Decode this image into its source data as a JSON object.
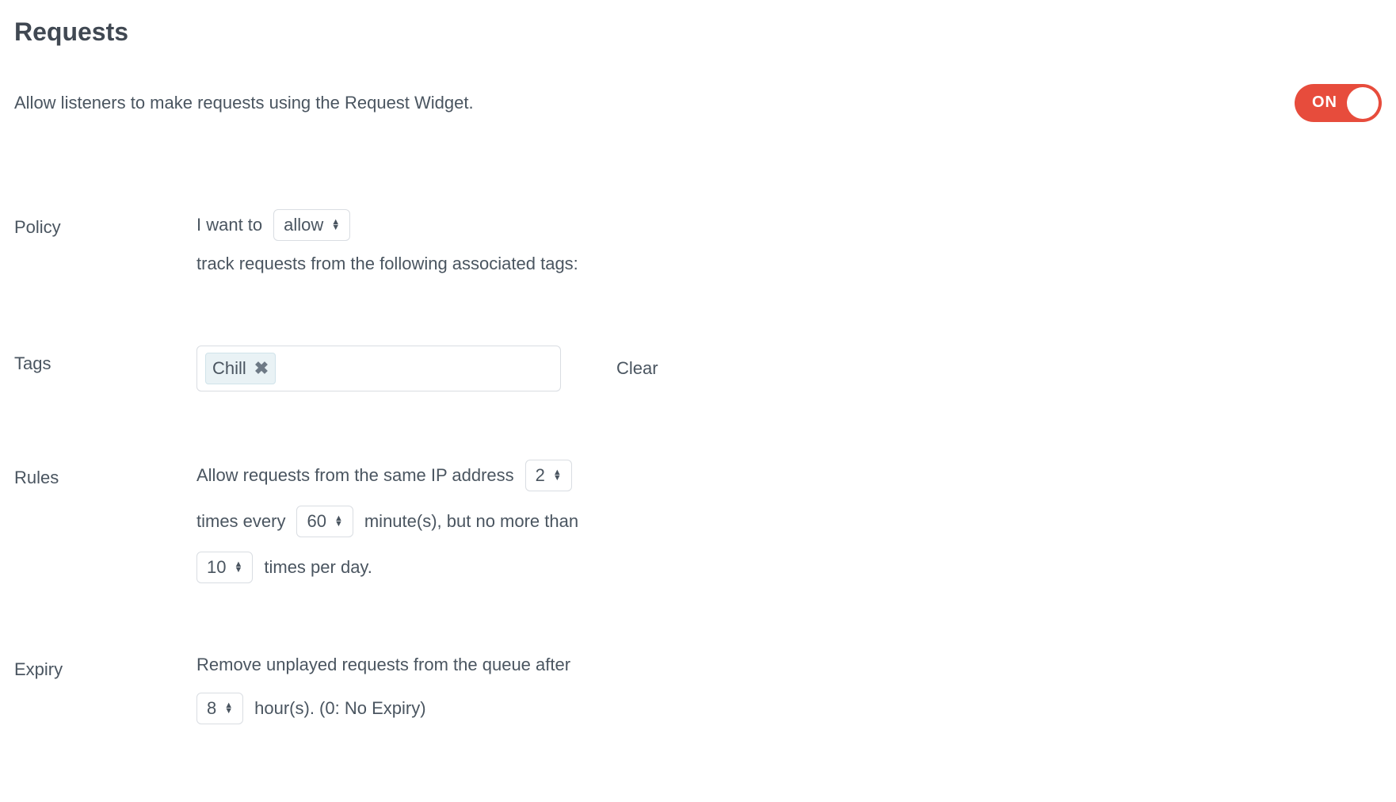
{
  "header": {
    "title": "Requests"
  },
  "description": "Allow listeners to make requests using the Request Widget.",
  "toggle": {
    "label": "ON",
    "on": true
  },
  "labels": {
    "policy": "Policy",
    "tags": "Tags",
    "rules": "Rules",
    "expiry": "Expiry"
  },
  "policy": {
    "prefix": "I want to",
    "selected": "allow",
    "suffix": "track requests from the following associated tags:"
  },
  "tags": {
    "items": [
      "Chill"
    ],
    "clear": "Clear"
  },
  "rules": {
    "line1_prefix": "Allow requests from the same IP address",
    "requests_per_window": "2",
    "line2_prefix": "times every",
    "window_minutes": "60",
    "line2_mid": "minute(s), but no more than",
    "max_per_day": "10",
    "line3_suffix": "times per day."
  },
  "expiry": {
    "prefix": "Remove unplayed requests from the queue after",
    "hours": "8",
    "suffix": "hour(s). (0: No Expiry)"
  }
}
